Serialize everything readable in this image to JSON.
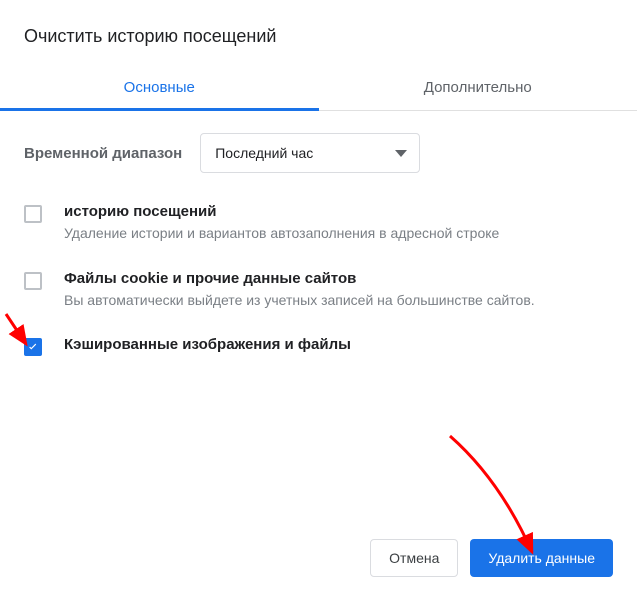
{
  "title": "Очистить историю посещений",
  "tabs": {
    "basic": "Основные",
    "advanced": "Дополнительно"
  },
  "range": {
    "label": "Временной диапазон",
    "value": "Последний час"
  },
  "options": [
    {
      "title": "историю посещений",
      "desc": "Удаление истории и вариантов автозаполнения в адресной строке",
      "checked": false
    },
    {
      "title": "Файлы cookie и прочие данные сайтов",
      "desc": "Вы автоматически выйдете из учетных записей на большинстве сайтов.",
      "checked": false
    },
    {
      "title": "Кэшированные изображения и файлы",
      "desc": "",
      "checked": true
    }
  ],
  "buttons": {
    "cancel": "Отмена",
    "confirm": "Удалить данные"
  }
}
